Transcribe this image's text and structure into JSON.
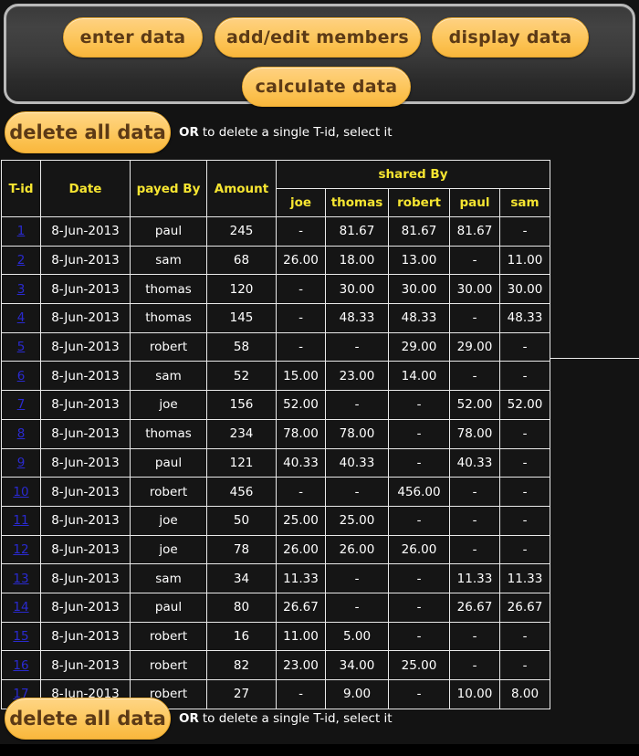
{
  "toolbar": {
    "buttons": [
      {
        "id": "enter-data",
        "label": "enter data"
      },
      {
        "id": "add-edit-members",
        "label": "add/edit members"
      },
      {
        "id": "display-data",
        "label": "display data"
      },
      {
        "id": "calculate-data",
        "label": "calculate data"
      }
    ]
  },
  "delete_bar": {
    "button_label": "delete all data",
    "hint_bold": "OR",
    "hint_text": "to delete a single T-id, select it"
  },
  "table": {
    "group_header": "shared By",
    "headers": {
      "tid": "T-id",
      "date": "Date",
      "payed_by": "payed By",
      "amount": "Amount"
    },
    "members": [
      "joe",
      "thomas",
      "robert",
      "paul",
      "sam"
    ],
    "rows": [
      {
        "tid": "1",
        "date": "8-Jun-2013",
        "payed_by": "paul",
        "amount": "245",
        "shares": [
          "-",
          "81.67",
          "81.67",
          "81.67",
          "-"
        ]
      },
      {
        "tid": "2",
        "date": "8-Jun-2013",
        "payed_by": "sam",
        "amount": "68",
        "shares": [
          "26.00",
          "18.00",
          "13.00",
          "-",
          "11.00"
        ]
      },
      {
        "tid": "3",
        "date": "8-Jun-2013",
        "payed_by": "thomas",
        "amount": "120",
        "shares": [
          "-",
          "30.00",
          "30.00",
          "30.00",
          "30.00"
        ]
      },
      {
        "tid": "4",
        "date": "8-Jun-2013",
        "payed_by": "thomas",
        "amount": "145",
        "shares": [
          "-",
          "48.33",
          "48.33",
          "-",
          "48.33"
        ]
      },
      {
        "tid": "5",
        "date": "8-Jun-2013",
        "payed_by": "robert",
        "amount": "58",
        "shares": [
          "-",
          "-",
          "29.00",
          "29.00",
          "-"
        ]
      },
      {
        "tid": "6",
        "date": "8-Jun-2013",
        "payed_by": "sam",
        "amount": "52",
        "shares": [
          "15.00",
          "23.00",
          "14.00",
          "-",
          "-"
        ]
      },
      {
        "tid": "7",
        "date": "8-Jun-2013",
        "payed_by": "joe",
        "amount": "156",
        "shares": [
          "52.00",
          "-",
          "-",
          "52.00",
          "52.00"
        ]
      },
      {
        "tid": "8",
        "date": "8-Jun-2013",
        "payed_by": "thomas",
        "amount": "234",
        "shares": [
          "78.00",
          "78.00",
          "-",
          "78.00",
          "-"
        ]
      },
      {
        "tid": "9",
        "date": "8-Jun-2013",
        "payed_by": "paul",
        "amount": "121",
        "shares": [
          "40.33",
          "40.33",
          "-",
          "40.33",
          "-"
        ]
      },
      {
        "tid": "10",
        "date": "8-Jun-2013",
        "payed_by": "robert",
        "amount": "456",
        "shares": [
          "-",
          "-",
          "456.00",
          "-",
          "-"
        ]
      },
      {
        "tid": "11",
        "date": "8-Jun-2013",
        "payed_by": "joe",
        "amount": "50",
        "shares": [
          "25.00",
          "25.00",
          "-",
          "-",
          "-"
        ]
      },
      {
        "tid": "12",
        "date": "8-Jun-2013",
        "payed_by": "joe",
        "amount": "78",
        "shares": [
          "26.00",
          "26.00",
          "26.00",
          "-",
          "-"
        ]
      },
      {
        "tid": "13",
        "date": "8-Jun-2013",
        "payed_by": "sam",
        "amount": "34",
        "shares": [
          "11.33",
          "-",
          "-",
          "11.33",
          "11.33"
        ]
      },
      {
        "tid": "14",
        "date": "8-Jun-2013",
        "payed_by": "paul",
        "amount": "80",
        "shares": [
          "26.67",
          "-",
          "-",
          "26.67",
          "26.67"
        ]
      },
      {
        "tid": "15",
        "date": "8-Jun-2013",
        "payed_by": "robert",
        "amount": "16",
        "shares": [
          "11.00",
          "5.00",
          "-",
          "-",
          "-"
        ]
      },
      {
        "tid": "16",
        "date": "8-Jun-2013",
        "payed_by": "robert",
        "amount": "82",
        "shares": [
          "23.00",
          "34.00",
          "25.00",
          "-",
          "-"
        ]
      },
      {
        "tid": "17",
        "date": "8-Jun-2013",
        "payed_by": "robert",
        "amount": "27",
        "shares": [
          "-",
          "9.00",
          "-",
          "10.00",
          "8.00"
        ]
      }
    ]
  },
  "colors": {
    "page_background": "#131313",
    "button_fill": "#fbc14e",
    "button_text": "#5c3a16",
    "header_text": "#f6e531",
    "cell_text": "#ffffff",
    "link_text": "#2a2ad0",
    "grid_line": "#e9e9e9",
    "panel_border": "#b9b9b9"
  }
}
